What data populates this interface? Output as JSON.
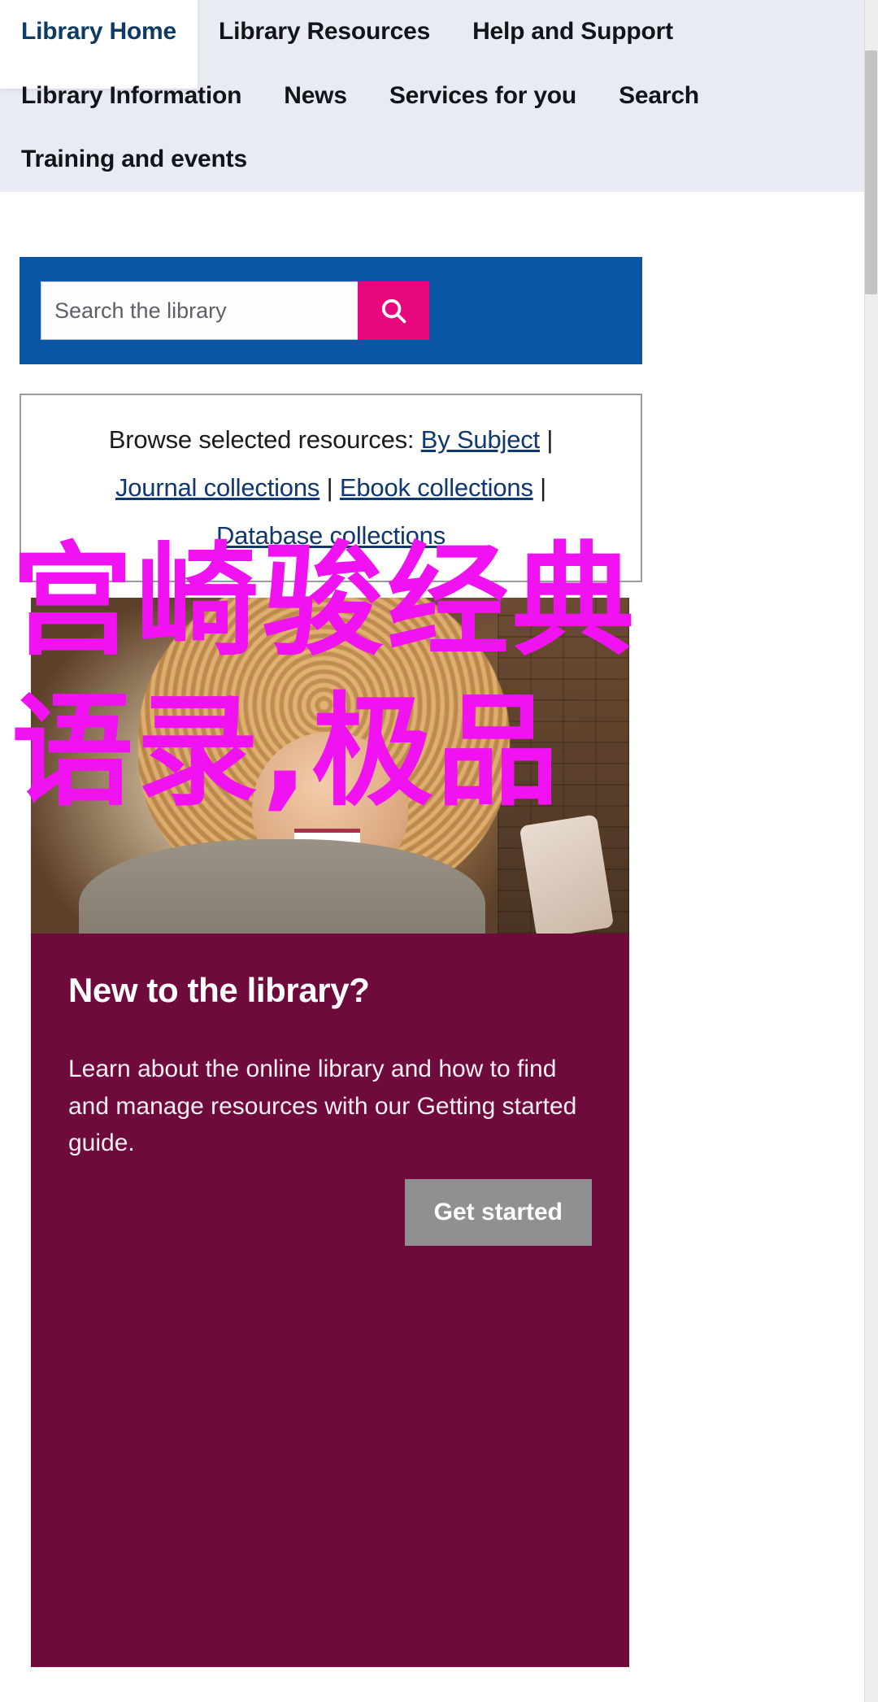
{
  "nav": {
    "items": [
      {
        "label": "Library Home",
        "active": true
      },
      {
        "label": "Library Resources",
        "active": false
      },
      {
        "label": "Help and Support",
        "active": false
      },
      {
        "label": "Library Information",
        "active": false
      },
      {
        "label": "News",
        "active": false
      },
      {
        "label": "Services for you",
        "active": false
      },
      {
        "label": "Search",
        "active": false
      },
      {
        "label": "Training and events",
        "active": false
      }
    ]
  },
  "search": {
    "placeholder": "Search the library",
    "value": "",
    "button_icon": "search-icon",
    "panel_color": "#0b56a4",
    "button_color": "#e8077d"
  },
  "browse": {
    "prefix": "Browse selected resources: ",
    "separator": " | ",
    "links": [
      "By Subject",
      "Journal collections",
      "Ebook collections",
      "Database collections"
    ],
    "link_color": "#10386e"
  },
  "promo": {
    "title": "New to the library?",
    "body": "Learn about the online library and how to find and manage resources with our Getting started guide.",
    "cta_label": "Get started",
    "card_color": "#6e0b3c",
    "cta_color": "#909090",
    "image_alt": "smiling-person-with-phone-photo"
  },
  "overlay": {
    "line1": "宫崎骏经典",
    "line2": "语录,极品",
    "color": "#f012f0"
  },
  "scrollbar": {
    "position": "right"
  }
}
